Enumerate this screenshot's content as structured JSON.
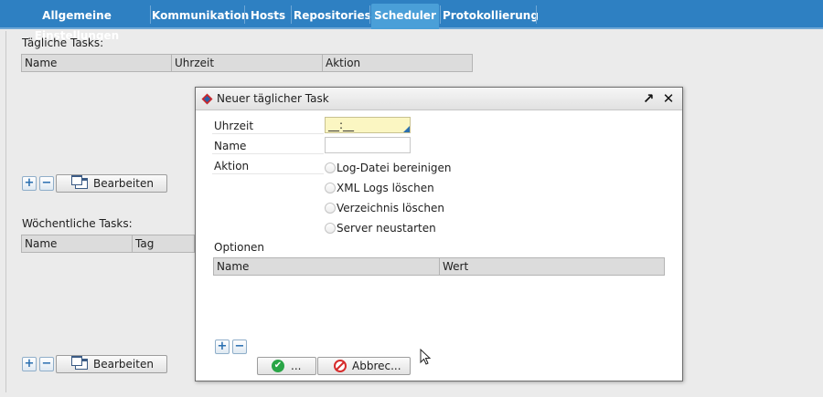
{
  "tabs": [
    {
      "label": "Allgemeine Einstellungen",
      "active": false
    },
    {
      "label": "Kommunikation",
      "active": false
    },
    {
      "label": "Hosts",
      "active": false
    },
    {
      "label": "Repositories",
      "active": false
    },
    {
      "label": "Scheduler",
      "active": true
    },
    {
      "label": "Protokollierung",
      "active": false
    }
  ],
  "daily": {
    "label": "Tägliche Tasks:",
    "columns": [
      "Name",
      "Uhrzeit",
      "Aktion"
    ],
    "edit_label": "Bearbeiten"
  },
  "weekly": {
    "label": "Wöchentliche Tasks:",
    "columns": [
      "Name",
      "Tag"
    ],
    "edit_label": "Bearbeiten"
  },
  "dialog": {
    "title": "Neuer täglicher Task",
    "time_label": "Uhrzeit",
    "time_value": "__:__",
    "name_label": "Name",
    "name_value": "",
    "action_label": "Aktion",
    "actions": [
      "Log-Datei bereinigen",
      "XML Logs löschen",
      "Verzeichnis löschen",
      "Server neustarten"
    ],
    "options_label": "Optionen",
    "option_columns": [
      "Name",
      "Wert"
    ],
    "ok_label": "...",
    "cancel_label": "Abbrec..."
  },
  "colors": {
    "tabbar": "#2e80c2",
    "active_tab": "#4a9fd8",
    "time_field": "#fbf6c2"
  }
}
